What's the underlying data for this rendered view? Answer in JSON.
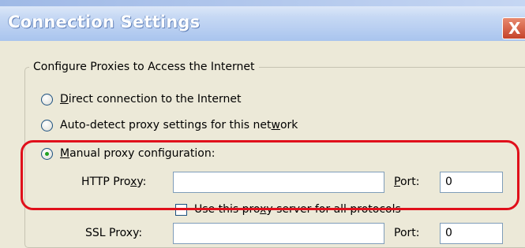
{
  "window": {
    "title": "Connection Settings",
    "close_glyph": "X"
  },
  "group": {
    "legend": "Configure Proxies to Access the Internet"
  },
  "options": {
    "direct": {
      "pre": "",
      "acc": "D",
      "post": "irect connection to the Internet",
      "checked": false
    },
    "auto_detect": {
      "pre": "Auto-detect proxy settings for this net",
      "acc": "w",
      "post": "ork",
      "checked": false
    },
    "manual": {
      "pre": "",
      "acc": "M",
      "post": "anual proxy configuration:",
      "checked": true
    }
  },
  "http_proxy": {
    "label_pre": "HTTP Pro",
    "label_acc": "x",
    "label_post": "y:",
    "value": "",
    "port_label_acc": "P",
    "port_label_post": "ort:",
    "port_value": "0"
  },
  "use_for_all": {
    "pre": "Use this pro",
    "acc": "x",
    "post": "y server for all protocols",
    "checked": false
  },
  "ssl_proxy": {
    "label": "SSL Proxy:",
    "value": "",
    "port_label": "Port:",
    "port_value": "0"
  },
  "colors": {
    "highlight": "#e0101b",
    "radio_checked": "#21a121",
    "background": "#ece9d8"
  }
}
